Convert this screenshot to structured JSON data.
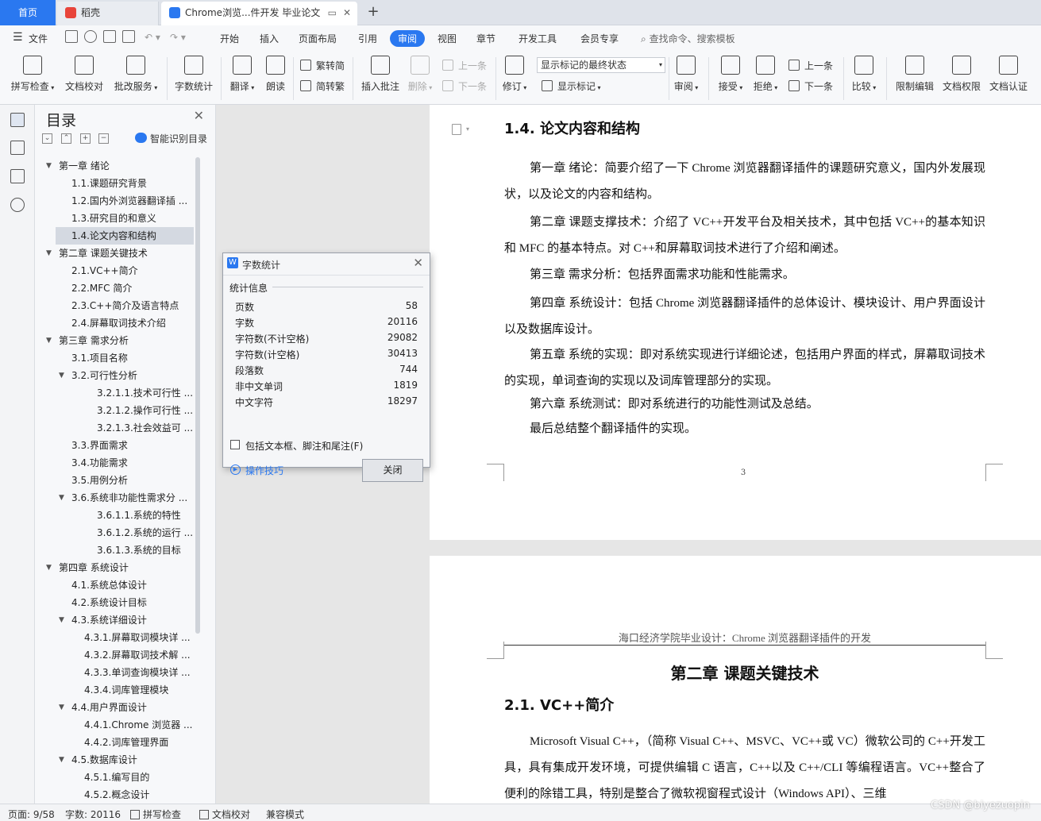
{
  "tabs": {
    "home": "首页",
    "daoke": "稻壳",
    "doc": "Chrome浏览...件开发 毕业论文",
    "new_tab_icon": "plus-icon"
  },
  "menu": {
    "file": "文件",
    "items": [
      "开始",
      "插入",
      "页面布局",
      "引用",
      "审阅",
      "视图",
      "章节",
      "开发工具",
      "会员专享"
    ],
    "active": "审阅",
    "search": "查找命令、搜索模板"
  },
  "ribbon": {
    "spellcheck": "拼写检查",
    "doc_check": "文档校对",
    "annotate_service": "批改服务",
    "word_count": "字数统计",
    "translate": "翻译",
    "read_aloud": "朗读",
    "to_traditional": "繁转简",
    "to_simplified": "简转繁",
    "insert_comment": "插入批注",
    "delete": "删除",
    "prev_comment": "上一条",
    "next_comment": "下一条",
    "revise": "修订",
    "markup_select": "显示标记的最终状态",
    "show_markup": "显示标记",
    "review": "审阅",
    "accept": "接受",
    "reject": "拒绝",
    "prev_change": "上一条",
    "next_change": "下一条",
    "compare": "比较",
    "restrict_edit": "限制编辑",
    "doc_permission": "文档权限",
    "doc_certify": "文档认证"
  },
  "toc": {
    "title": "目录",
    "smart": "智能识别目录",
    "items": [
      {
        "label": "第一章  绪论",
        "level": 1,
        "arrow": "down"
      },
      {
        "label": "1.1.课题研究背景",
        "level": 2
      },
      {
        "label": "1.2.国内外浏览器翻译插 ...",
        "level": 2
      },
      {
        "label": "1.3.研究目的和意义",
        "level": 2
      },
      {
        "label": "1.4.论文内容和结构",
        "level": 2,
        "selected": true
      },
      {
        "label": "第二章  课题关键技术",
        "level": 1,
        "arrow": "down"
      },
      {
        "label": "2.1.VC++简介",
        "level": 2
      },
      {
        "label": "2.2.MFC 简介",
        "level": 2
      },
      {
        "label": "2.3.C++简介及语言特点",
        "level": 2
      },
      {
        "label": "2.4.屏幕取词技术介绍",
        "level": 2
      },
      {
        "label": "第三章  需求分析",
        "level": 1,
        "arrow": "down"
      },
      {
        "label": "3.1.项目名称",
        "level": 2
      },
      {
        "label": "3.2.可行性分析",
        "level": 2,
        "arrow": "down"
      },
      {
        "label": "3.2.1.1.技术可行性 ...",
        "level": 4
      },
      {
        "label": "3.2.1.2.操作可行性 ...",
        "level": 4
      },
      {
        "label": "3.2.1.3.社会效益可 ...",
        "level": 4
      },
      {
        "label": "3.3.界面需求",
        "level": 2
      },
      {
        "label": "3.4.功能需求",
        "level": 2
      },
      {
        "label": "3.5.用例分析",
        "level": 2
      },
      {
        "label": "3.6.系统非功能性需求分 ...",
        "level": 2,
        "arrow": "down"
      },
      {
        "label": "3.6.1.1.系统的特性",
        "level": 4
      },
      {
        "label": "3.6.1.2.系统的运行 ...",
        "level": 4
      },
      {
        "label": "3.6.1.3.系统的目标",
        "level": 4
      },
      {
        "label": "第四章  系统设计",
        "level": 1,
        "arrow": "down"
      },
      {
        "label": "4.1.系统总体设计",
        "level": 2
      },
      {
        "label": "4.2.系统设计目标",
        "level": 2
      },
      {
        "label": "4.3.系统详细设计",
        "level": 2,
        "arrow": "down"
      },
      {
        "label": "4.3.1.屏幕取词模块详 ...",
        "level": 3
      },
      {
        "label": "4.3.2.屏幕取词技术解 ...",
        "level": 3
      },
      {
        "label": "4.3.3.单词查询模块详 ...",
        "level": 3
      },
      {
        "label": "4.3.4.词库管理模块",
        "level": 3
      },
      {
        "label": "4.4.用户界面设计",
        "level": 2,
        "arrow": "down"
      },
      {
        "label": "4.4.1.Chrome 浏览器 ...",
        "level": 3
      },
      {
        "label": "4.4.2.词库管理界面",
        "level": 3
      },
      {
        "label": "4.5.数据库设计",
        "level": 2,
        "arrow": "down"
      },
      {
        "label": "4.5.1.编写目的",
        "level": 3
      },
      {
        "label": "4.5.2.概念设计",
        "level": 3
      }
    ]
  },
  "page1": {
    "heading": "1.4. 论文内容和结构",
    "paragraphs": [
      "第一章  绪论：简要介绍了一下 Chrome 浏览器翻译插件的课题研究意义，国内外发展现状，以及论文的内容和结构。",
      "第二章  课题支撑技术：介绍了 VC++开发平台及相关技术，其中包括 VC++的基本知识和 MFC 的基本特点。对 C++和屏幕取词技术进行了介绍和阐述。",
      "第三章  需求分析：包括界面需求功能和性能需求。",
      "第四章  系统设计：包括 Chrome 浏览器翻译插件的总体设计、模块设计、用户界面设计以及数据库设计。",
      "第五章  系统的实现：即对系统实现进行详细论述，包括用户界面的样式，屏幕取词技术的实现，单词查询的实现以及词库管理部分的实现。",
      "第六章  系统测试：即对系统进行的功能性测试及总结。",
      "最后总结整个翻译插件的实现。"
    ],
    "page_number": "3"
  },
  "page2": {
    "header": "海口经济学院毕业设计：Chrome 浏览器翻译插件的开发",
    "chapter": "第二章  课题关键技术",
    "heading": "2.1.  VC++简介",
    "paragraph": "Microsoft Visual C++，（简称 Visual C++、MSVC、VC++或 VC）微软公司的 C++开发工具，具有集成开发环境，可提供编辑 C 语言，C++以及 C++/CLI 等编程语言。VC++整合了便利的除错工具，特别是整合了微软视窗程式设计（Windows API）、三维"
  },
  "dialog": {
    "title": "字数统计",
    "group": "统计信息",
    "stats": [
      {
        "label": "页数",
        "value": "58"
      },
      {
        "label": "字数",
        "value": "20116"
      },
      {
        "label": "字符数(不计空格)",
        "value": "29082"
      },
      {
        "label": "字符数(计空格)",
        "value": "30413"
      },
      {
        "label": "段落数",
        "value": "744"
      },
      {
        "label": "非中文单词",
        "value": "1819"
      },
      {
        "label": "中文字符",
        "value": "18297"
      }
    ],
    "checkbox": "包括文本框、脚注和尾注(F)",
    "tips": "操作技巧",
    "close": "关闭"
  },
  "statusbar": {
    "page": "页面: 9/58",
    "words": "字数: 20116",
    "spell": "拼写检查",
    "doc_check": "文档校对",
    "compat": "兼容模式"
  },
  "watermark": "CSDN @biyezuopin",
  "colors": {
    "accent": "#2a78f0"
  }
}
